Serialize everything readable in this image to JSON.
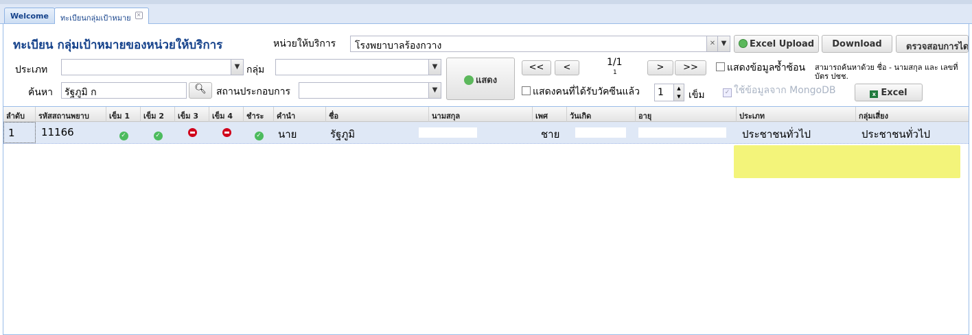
{
  "tabs": [
    {
      "label": "Welcome",
      "active": false
    },
    {
      "label": "ทะเบียนกลุ่มเป้าหมาย",
      "active": true,
      "close_icon": "close-icon"
    }
  ],
  "form": {
    "title": "ทะเบียน กลุ่มเป้าหมายของหน่วยให้บริการ",
    "unit_label": "หน่วยให้บริการ",
    "unit_value": "โรงพยาบาลร้องกวาง",
    "type_label": "ประเภท",
    "type_value": "",
    "group_label": "กลุ่ม",
    "group_value": "",
    "search_label": "ค้นหา",
    "search_value": "รัฐภูมิ ก",
    "workplace_label": "สถานประกอบการ",
    "workplace_value": "",
    "show_button": "แสดง",
    "pager": {
      "first": "<<",
      "prev": "<",
      "next": ">",
      "last": ">>",
      "page": "1/1",
      "page_sub": "1"
    },
    "dup_check_label": "แสดงข้อมูลซ้ำซ้อน",
    "vacc_check_label": "แสดงคนที่ได้รับวัคซีนแล้ว",
    "dose_value": "1",
    "dose_unit": "เข็ม",
    "mongo_label": "ใช้ข้อมูลจาก MongoDB",
    "search_hint": "สามารถค้นหาด้วย ชื่อ - นามสกุล และ เลขที่บัตร ปชช.",
    "excel_upload": "Excel Upload",
    "download": "Download",
    "verify": "ตรวจสอบการได",
    "excel": "Excel"
  },
  "grid": {
    "columns": [
      "ลำดับ",
      "รหัสสถานพยาบ",
      "เข็ม 1",
      "เข็ม 2",
      "เข็ม 3",
      "เข็ม 4",
      "ชำระ",
      "คำนำ",
      "ชื่อ",
      "นามสกุล",
      "เพศ",
      "วันเกิด",
      "อายุ",
      "ประเภท",
      "กลุ่มเสี่ยง"
    ],
    "rows": [
      {
        "index": "1",
        "hospital_code": "11166",
        "dose1": "ok",
        "dose2": "ok",
        "dose3": "no",
        "dose4": "no",
        "paid": "ok",
        "prefix": "นาย",
        "first_name": "รัฐภูมิ",
        "last_name": "",
        "sex": "ชาย",
        "birth_date": "",
        "age": "",
        "type": "ประชาชนทั่วไป",
        "risk_group": "ประชาชนทั่วไป"
      }
    ]
  },
  "colors": {
    "highlight": "#ebee28",
    "title": "#15428b",
    "ok": "#4cbb5e",
    "no": "#d0021b"
  }
}
